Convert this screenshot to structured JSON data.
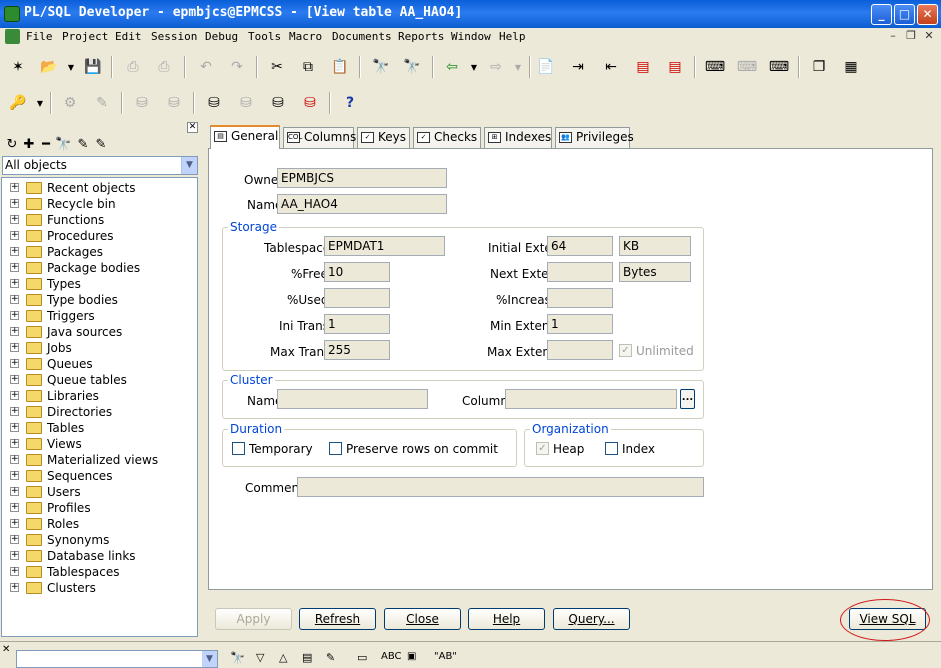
{
  "window": {
    "title": "PL/SQL Developer - epmbjcs@EPMCSS - [View table AA_HAO4]"
  },
  "menu": [
    "File",
    "Project",
    "Edit",
    "Session",
    "Debug",
    "Tools",
    "Macro",
    "Documents",
    "Reports",
    "Window",
    "Help"
  ],
  "object_browser": {
    "filter": "All objects",
    "items": [
      "Recent objects",
      "Recycle bin",
      "Functions",
      "Procedures",
      "Packages",
      "Package bodies",
      "Types",
      "Type bodies",
      "Triggers",
      "Java sources",
      "Jobs",
      "Queues",
      "Queue tables",
      "Libraries",
      "Directories",
      "Tables",
      "Views",
      "Materialized views",
      "Sequences",
      "Users",
      "Profiles",
      "Roles",
      "Synonyms",
      "Database links",
      "Tablespaces",
      "Clusters"
    ]
  },
  "tabs": [
    "General",
    "Columns",
    "Keys",
    "Checks",
    "Indexes",
    "Privileges"
  ],
  "general": {
    "owner_label": "Owner",
    "owner": "EPMBJCS",
    "name_label": "Name",
    "name": "AA_HAO4",
    "storage": {
      "title": "Storage",
      "tablespace_label": "Tablespace",
      "tablespace": "EPMDAT1",
      "pctfree_label": "%Free",
      "pctfree": "10",
      "pctused_label": "%Used",
      "pctused": "",
      "initrans_label": "Ini Trans",
      "initrans": "1",
      "maxtrans_label": "Max Trans",
      "maxtrans": "255",
      "initial_extent_label": "Initial Extent",
      "initial_extent": "64",
      "initial_extent_unit": "KB",
      "next_extent_label": "Next Extent",
      "next_extent": "",
      "next_extent_unit": "Bytes",
      "pctincrease_label": "%Increase",
      "pctincrease": "",
      "min_extents_label": "Min Extents",
      "min_extents": "1",
      "max_extents_label": "Max Extents",
      "max_extents": "",
      "unlimited_label": "Unlimited"
    },
    "cluster": {
      "title": "Cluster",
      "name_label": "Name",
      "columns_label": "Columns",
      "ellipsis": "..."
    },
    "duration": {
      "title": "Duration",
      "temporary_label": "Temporary",
      "preserve_label": "Preserve rows on commit"
    },
    "organization": {
      "title": "Organization",
      "heap_label": "Heap",
      "index_label": "Index"
    },
    "comments_label": "Comments",
    "comments": ""
  },
  "buttons": {
    "apply": "Apply",
    "refresh": "Refresh",
    "close": "Close",
    "help": "Help",
    "query": "Query...",
    "view_sql": "View SQL"
  },
  "statusbar": {
    "abc": "ABC",
    "ab_quoted": "\"AB\""
  }
}
